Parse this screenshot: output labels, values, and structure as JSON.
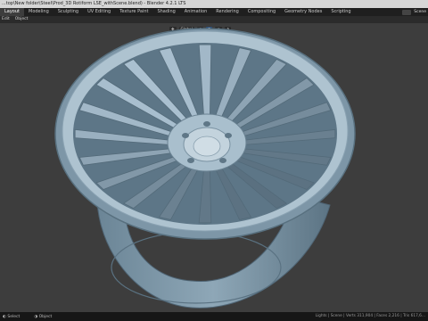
{
  "window": {
    "title": "...top\\New folder\\Steel\\Prod_3D Rotiform LSE_withScene.blend) - Blender 4.2.1 LTS"
  },
  "workspaces": {
    "tabs": [
      "Layout",
      "Modeling",
      "Sculpting",
      "UV Editing",
      "Texture Paint",
      "Shading",
      "Animation",
      "Rendering",
      "Compositing",
      "Geometry Nodes",
      "Scripting"
    ],
    "active": "Layout",
    "scene_label": "Scene"
  },
  "viewport_menu": {
    "items": [
      "Edit",
      "Object"
    ]
  },
  "viewport_header": {
    "orientation": "Global",
    "extra_buttons": [
      "snap",
      "overlay",
      "shading"
    ]
  },
  "statusbar": {
    "left_items": [
      "Select",
      "Object"
    ],
    "right_text": "Lights | Scene | Verts 311,904 | Faces 2,216 | Tris 617,6..."
  },
  "colors": {
    "viewport_bg": "#3d3d3d",
    "wheel_base": "#8aa3b3",
    "wheel_light": "#b9cbd6",
    "wheel_dark": "#5f7787",
    "accent": "#2a4e7a"
  },
  "icons": [
    "blender-logo-icon",
    "scene-icon",
    "orientation-icon",
    "snap-icon",
    "overlay-icon",
    "mouse-icon"
  ]
}
